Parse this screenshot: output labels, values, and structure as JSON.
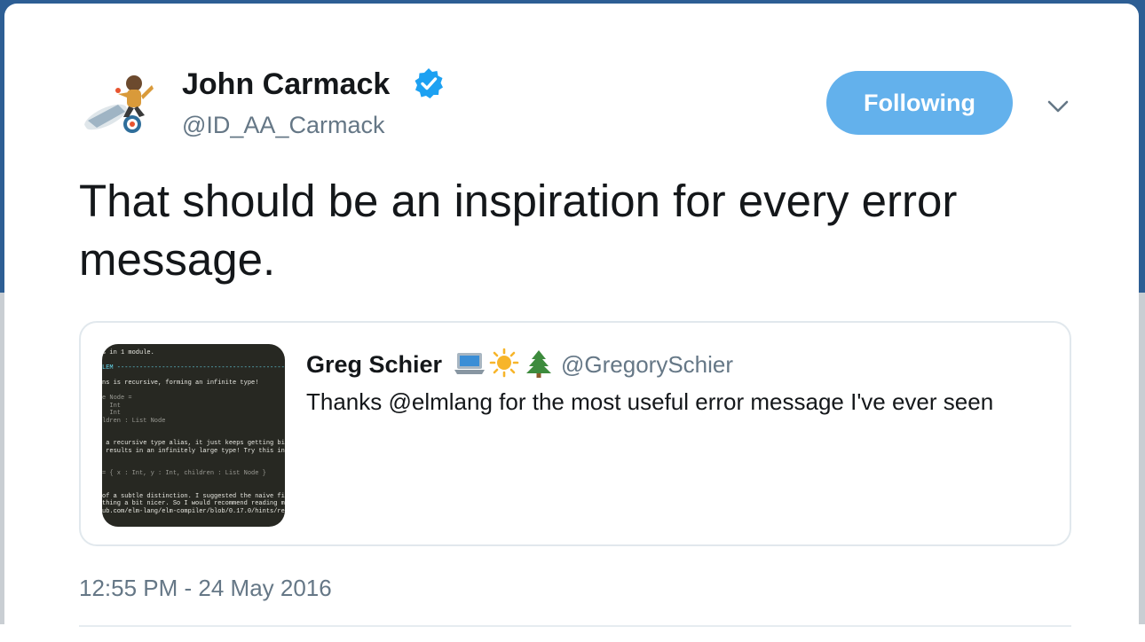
{
  "tweet": {
    "author": {
      "name": "John Carmack",
      "handle": "@ID_AA_Carmack",
      "verified": true,
      "avatar_icon": "astronaut-rocket-avatar"
    },
    "follow_button_label": "Following",
    "menu_icon": "chevron-down-icon",
    "text": "That should be an inspiration for every error message.",
    "timestamp": "12:55 PM - 24 May 2016",
    "quoted_tweet": {
      "name": "Greg Schier",
      "name_emoji_icons": [
        "laptop-icon",
        "sun-icon",
        "tree-icon"
      ],
      "handle": "@GregorySchier",
      "text": "Thanks @elmlang for the most useful error message I've ever seen",
      "media_icon": "terminal-screenshot"
    }
  },
  "colors": {
    "accent": "#1da1f2",
    "button_bg": "#63b1ec",
    "secondary_text": "#657786",
    "primary_text": "#14171a",
    "page_backdrop_top": "#2d5e94",
    "page_backdrop_bottom": "#c9ced3"
  }
}
